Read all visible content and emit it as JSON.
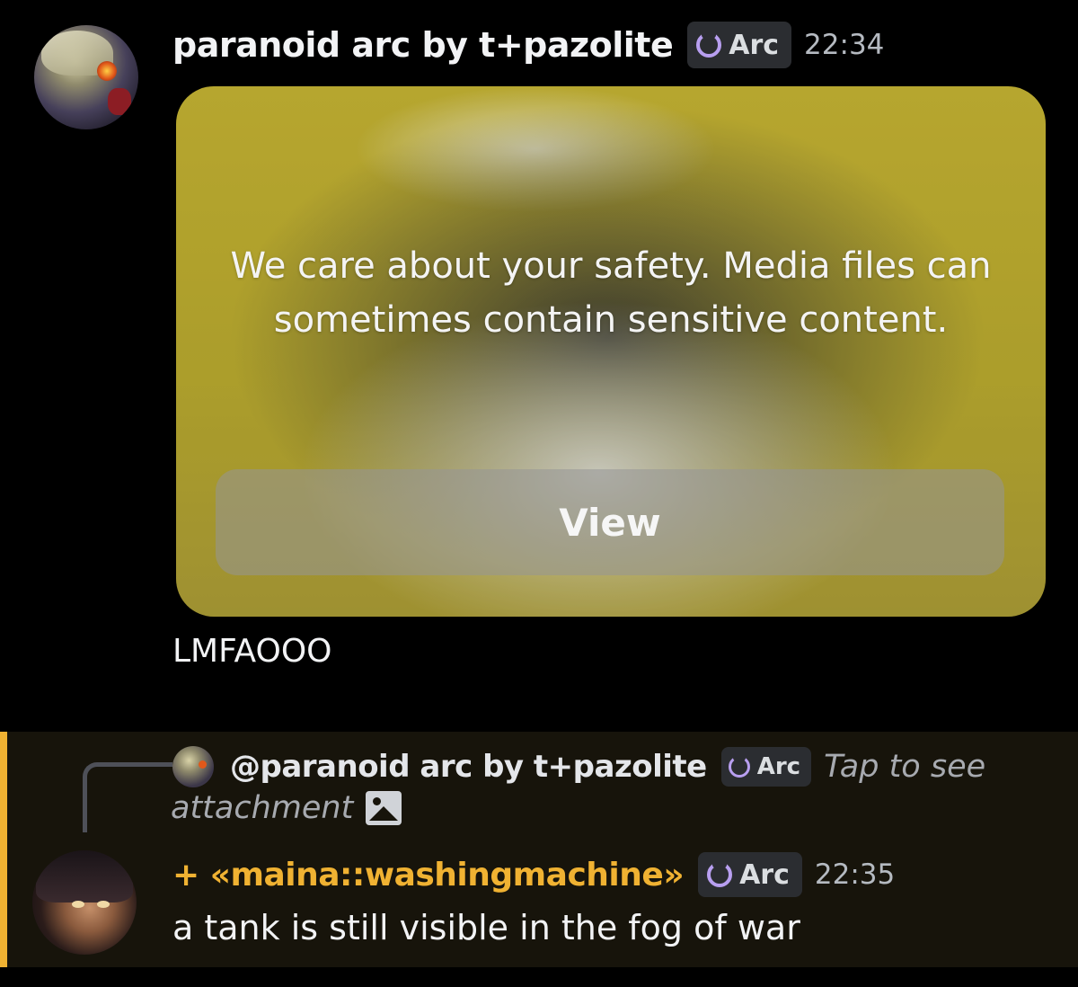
{
  "message1": {
    "author": "paranoid arc by t+pazolite",
    "tag": "Arc",
    "time": "22:34",
    "media": {
      "warning": "We care about your safety. Media files can sometimes contain sensitive content.",
      "button_label": "View"
    },
    "text": "LMFAOOO"
  },
  "message2": {
    "reply": {
      "ref_author": "@paranoid arc by t+pazolite",
      "tag": "Arc",
      "hint_part1": "Tap to see",
      "hint_part2": "attachment",
      "icon": "image-icon"
    },
    "author": "+ «maina::washingmachine»",
    "tag": "Arc",
    "time": "22:35",
    "text": "a tank is still visible in the fog of war"
  },
  "colors": {
    "background": "#000000",
    "highlight_background": "#17140b",
    "highlight_accent": "#f0b232",
    "username_highlight": "#f0b232",
    "tag_background": "#2b2d31",
    "tag_icon": "#b89ff0"
  }
}
